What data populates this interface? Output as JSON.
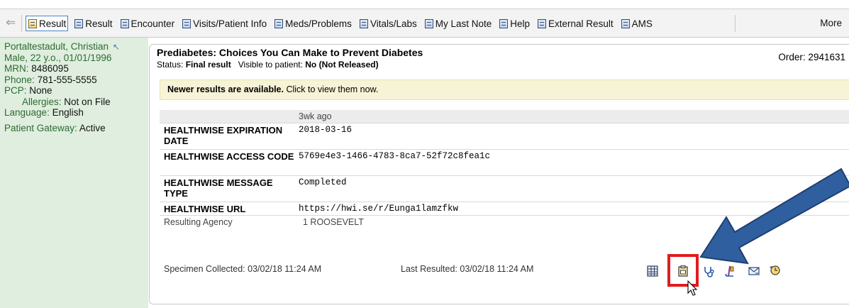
{
  "toolbar": {
    "tabs": [
      {
        "label": "Result",
        "active": true
      },
      {
        "label": "Result",
        "active": false
      },
      {
        "label": "Encounter",
        "active": false
      },
      {
        "label": "Visits/Patient Info",
        "active": false
      },
      {
        "label": "Meds/Problems",
        "active": false
      },
      {
        "label": "Vitals/Labs",
        "active": false
      },
      {
        "label": "My Last Note",
        "active": false
      },
      {
        "label": "Help",
        "active": false
      },
      {
        "label": "External Result",
        "active": false
      },
      {
        "label": "AMS",
        "active": false
      }
    ],
    "more_label": "More"
  },
  "patient": {
    "name": "Portaltestadult, Christian",
    "demographics": "Male, 22 y.o., 01/01/1996",
    "mrn_label": "MRN:",
    "mrn": "8486095",
    "phone_label": "Phone:",
    "phone": "781-555-5555",
    "pcp_label": "PCP:",
    "pcp": "None",
    "allergies_label": "Allergies:",
    "allergies": "Not on File",
    "language_label": "Language:",
    "language": "English",
    "gateway_label": "Patient Gateway:",
    "gateway": "Active"
  },
  "result": {
    "title": "Prediabetes: Choices You Can Make to Prevent Diabetes",
    "status_label": "Status:",
    "status": "Final result",
    "visible_label": "Visible to patient:",
    "visible": "No (Not Released)",
    "order": "Order: 2941631",
    "notice_bold": "Newer results are available.",
    "notice_text": "Click to view them now.",
    "column_header": "3wk ago",
    "rows": [
      {
        "label": "HEALTHWISE EXPIRATION DATE",
        "value": "2018-03-16"
      },
      {
        "label": "HEALTHWISE ACCESS CODE",
        "value": "5769e4e3-1466-4783-8ca7-52f72c8fea1c"
      },
      {
        "label": "HEALTHWISE MESSAGE TYPE",
        "value": "Completed"
      },
      {
        "label": "HEALTHWISE URL",
        "value": "https://hwi.se/r/Eunga1lamzfkw"
      }
    ],
    "agency_label": "Resulting Agency",
    "agency_value": "1 ROOSEVELT",
    "specimen": "Specimen Collected: 03/02/18 11:24 AM",
    "last_resulted": "Last Resulted: 03/02/18 11:24 AM"
  },
  "icons": {
    "grid": "table-icon",
    "clipboard": "clipboard-print-icon",
    "stethoscope": "stethoscope-icon",
    "hammer": "reflex-icon",
    "envelope": "envelope-icon",
    "history": "history-icon"
  },
  "colors": {
    "highlight": "#e21b1b",
    "arrow": "#2f5f9e",
    "sidebar": "#dfeede",
    "notice": "#f6f3d6"
  }
}
